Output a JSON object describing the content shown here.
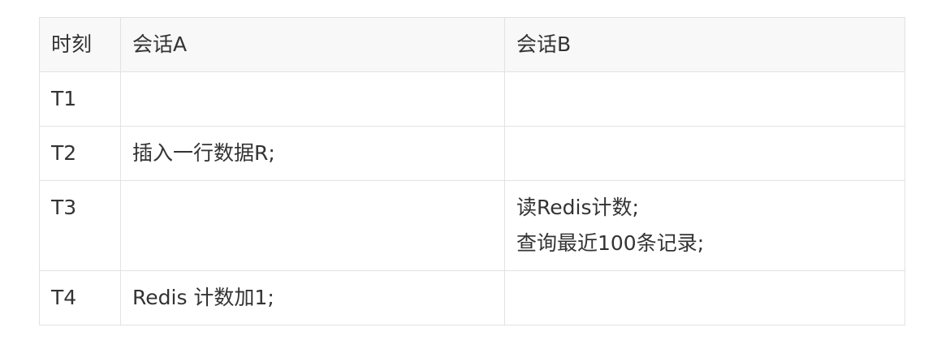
{
  "table": {
    "headers": [
      "时刻",
      "会话A",
      "会话B"
    ],
    "rows": [
      {
        "time": "T1",
        "session_a": "",
        "session_b": ""
      },
      {
        "time": "T2",
        "session_a": "插入一行数据R;",
        "session_b": ""
      },
      {
        "time": "T3",
        "session_a": "",
        "session_b_lines": [
          "读Redis计数;",
          "查询最近100条记录;"
        ]
      },
      {
        "time": "T4",
        "session_a": "Redis 计数加1;",
        "session_b": ""
      }
    ]
  }
}
